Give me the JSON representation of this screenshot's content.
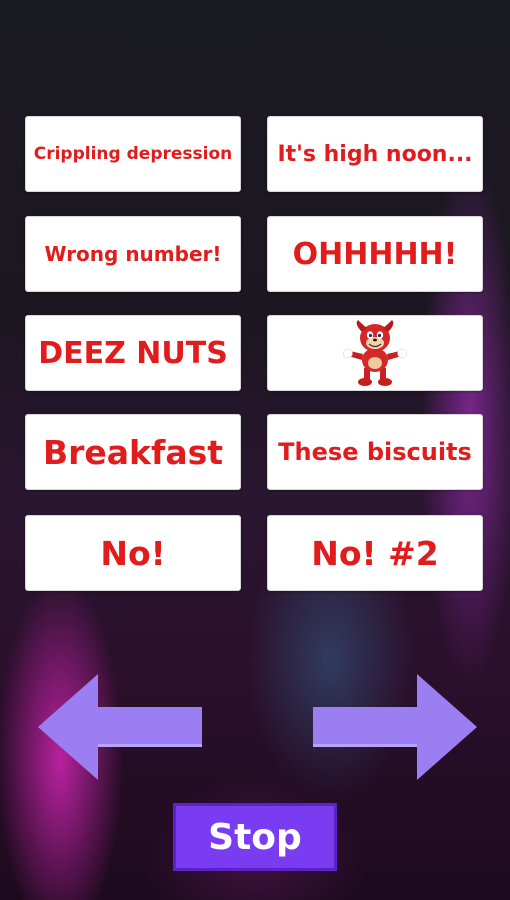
{
  "sounds": [
    {
      "label": "Crippling depression"
    },
    {
      "label": "It's high noon..."
    },
    {
      "label": "Wrong number!"
    },
    {
      "label": "OHHHHH!"
    },
    {
      "label": "DEEZ NUTS"
    },
    {
      "label": "",
      "icon": "knuckles-character-icon"
    },
    {
      "label": "Breakfast"
    },
    {
      "label": "These biscuits"
    },
    {
      "label": "No!"
    },
    {
      "label": "No! #2"
    }
  ],
  "navigation": {
    "previous_icon": "left-arrow-icon",
    "next_icon": "right-arrow-icon"
  },
  "stop_button": {
    "label": "Stop"
  },
  "colors": {
    "label_red": "#e01c1c",
    "arrow_lavender": "#9b7ff2",
    "stop_purple": "#7a3cf0"
  }
}
